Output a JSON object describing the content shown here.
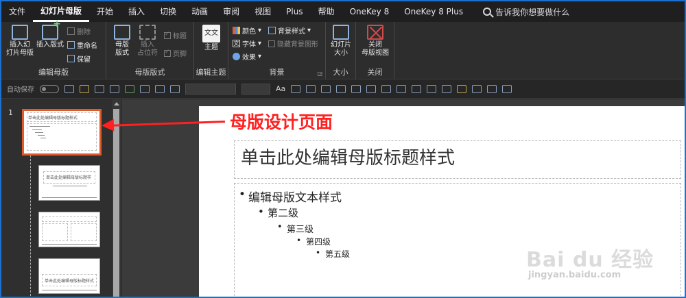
{
  "menu": {
    "tabs": [
      "文件",
      "幻灯片母版",
      "开始",
      "插入",
      "切换",
      "动画",
      "审阅",
      "视图",
      "Plus",
      "帮助",
      "OneKey 8",
      "OneKey 8 Plus"
    ],
    "active_tab": "幻灯片母版",
    "tell_me": "告诉我你想要做什么"
  },
  "ribbon": {
    "edit_master": {
      "label": "编辑母版",
      "insert_master": "插入幻\n灯片母版",
      "insert_layout": "插入版式",
      "delete": "删除",
      "rename": "重命名",
      "preserve": "保留"
    },
    "master_layout": {
      "label": "母版版式",
      "layout": "母版\n版式",
      "insert_placeholder": "插入\n占位符",
      "title_check": "标题",
      "footer_check": "页脚"
    },
    "edit_theme": {
      "label": "编辑主题",
      "theme": "主题",
      "theme_icon_text": "文文"
    },
    "background": {
      "label": "背景",
      "colors": "颜色",
      "fonts": "字体",
      "effects": "效果",
      "bg_styles": "背景样式",
      "hide_bg": "隐藏背景图形"
    },
    "size": {
      "label": "大小",
      "slide_size": "幻灯片\n大小"
    },
    "close": {
      "label": "关闭",
      "close_master": "关闭\n母版视图"
    }
  },
  "qat": {
    "autosave": "自动保存",
    "font_size_label": "Aa"
  },
  "thumbs": {
    "slide_number": "1",
    "master_title": "单击此处编辑母版标题样式",
    "layout1_title": "单击此处编辑母版标题样",
    "layout3_title": "单击此处编辑母版标题样式"
  },
  "slide": {
    "title": "单击此处编辑母版标题样式",
    "levels": [
      "编辑母版文本样式",
      "第二级",
      "第三级",
      "第四级",
      "第五级"
    ]
  },
  "annotation": {
    "text": "母版设计页面",
    "color": "#ff2020"
  },
  "watermark": {
    "logo": "Bai du 经验",
    "url": "jingyan.baidu.com"
  }
}
